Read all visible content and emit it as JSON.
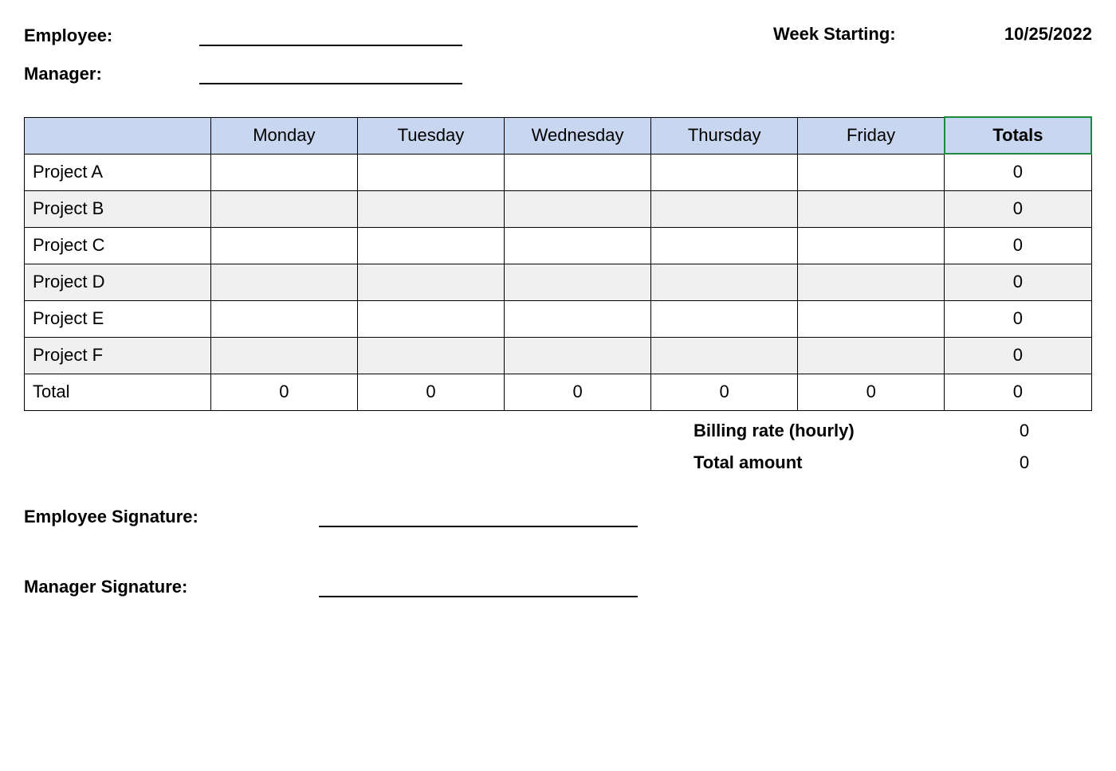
{
  "header": {
    "employee_label": "Employee:",
    "manager_label": "Manager:",
    "week_starting_label": "Week Starting:",
    "week_starting_value": "10/25/2022"
  },
  "table": {
    "days": [
      "Monday",
      "Tuesday",
      "Wednesday",
      "Thursday",
      "Friday"
    ],
    "totals_header": "Totals",
    "rows": [
      {
        "name": "Project A",
        "cells": [
          "",
          "",
          "",
          "",
          ""
        ],
        "total": "0"
      },
      {
        "name": "Project B",
        "cells": [
          "",
          "",
          "",
          "",
          ""
        ],
        "total": "0"
      },
      {
        "name": "Project C",
        "cells": [
          "",
          "",
          "",
          "",
          ""
        ],
        "total": "0"
      },
      {
        "name": "Project D",
        "cells": [
          "",
          "",
          "",
          "",
          ""
        ],
        "total": "0"
      },
      {
        "name": "Project E",
        "cells": [
          "",
          "",
          "",
          "",
          ""
        ],
        "total": "0"
      },
      {
        "name": "Project F",
        "cells": [
          "",
          "",
          "",
          "",
          ""
        ],
        "total": "0"
      }
    ],
    "total_row": {
      "label": "Total",
      "cells": [
        "0",
        "0",
        "0",
        "0",
        "0"
      ],
      "total": "0"
    }
  },
  "summary": {
    "billing_rate_label": "Billing rate (hourly)",
    "billing_rate_value": "0",
    "total_amount_label": "Total amount",
    "total_amount_value": "0"
  },
  "signatures": {
    "employee_sig_label": "Employee Signature:",
    "manager_sig_label": "Manager Signature:"
  }
}
